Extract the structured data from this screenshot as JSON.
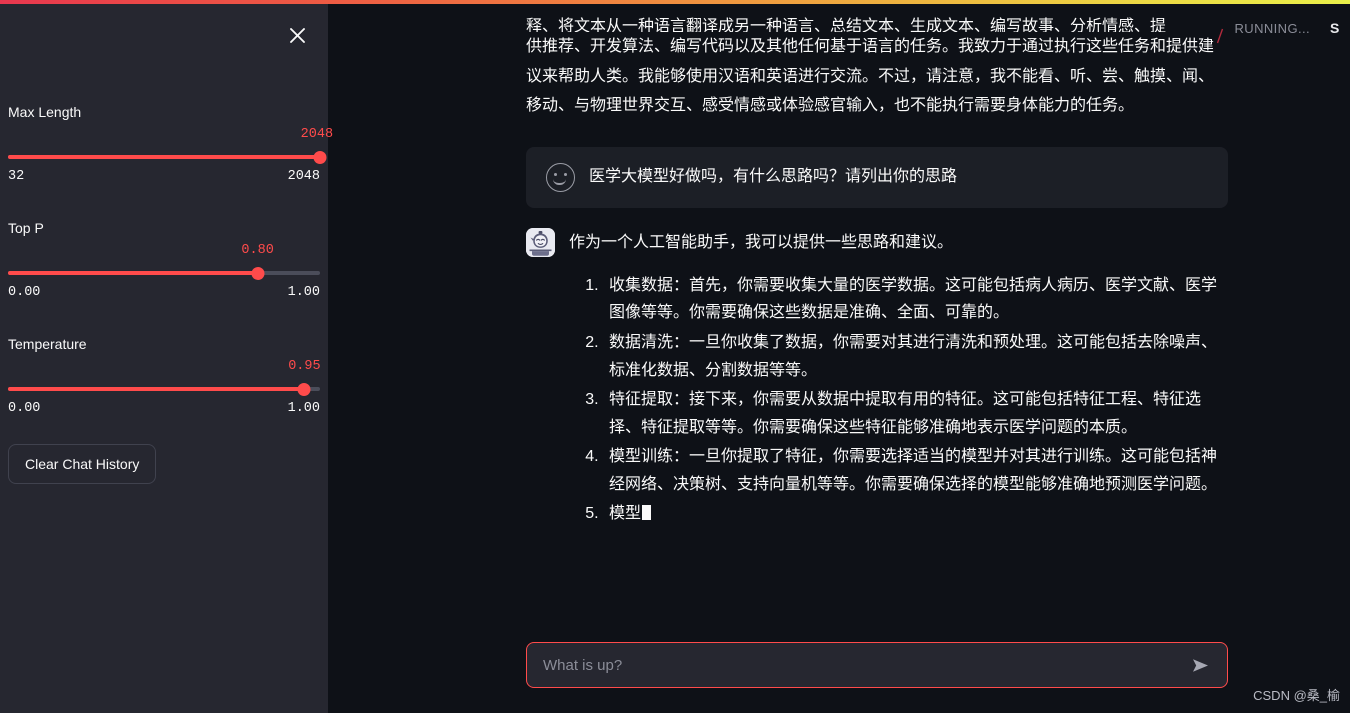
{
  "app": {
    "background": "#0e1117",
    "accent": "#ff4b4b",
    "sidebar_bg": "#262730"
  },
  "progress_bar": {
    "name": "running-progress-bar",
    "gradient_from": "#e8374f",
    "gradient_mid": "#f08a3f",
    "gradient_to": "#e9f04a"
  },
  "status": {
    "running_label": "RUNNING...",
    "stop_label": "S"
  },
  "sidebar": {
    "close_label": "×",
    "sliders": [
      {
        "label": "Max Length",
        "value": "2048",
        "min": "32",
        "max": "2048",
        "percent": 100
      },
      {
        "label": "Top P",
        "value": "0.80",
        "min": "0.00",
        "max": "1.00",
        "percent": 80
      },
      {
        "label": "Temperature",
        "value": "0.95",
        "min": "0.00",
        "max": "1.00",
        "percent": 95
      }
    ],
    "clear_button": "Clear Chat History"
  },
  "chat": {
    "scrolled_message": {
      "role": "assistant",
      "clipped_line": "释、将文本从一种语言翻译成另一种语言、总结文本、生成文本、编写故事、分析情感、提",
      "lines": [
        "供推荐、开发算法、编写代码以及其他任何基于语言的任务。我致力于通过执行这些任务和",
        "提供建议来帮助人类。我能够使用汉语和英语进行交流。不过，请注意，我不能看、听、",
        "尝、触摸、闻、移动、与物理世界交互、感受情感或体验感官输入，也不能执行需要身体能",
        "力的任务。"
      ]
    },
    "user_message": {
      "role": "user",
      "avatar": "smiley-face-icon",
      "text": "医学大模型好做吗，有什么思路吗？请列出你的思路"
    },
    "assistant_message": {
      "role": "assistant",
      "avatar": "monk-character-avatar",
      "lead": "作为一个人工智能助手，我可以提供一些思路和建议。",
      "steps": [
        "收集数据：首先，你需要收集大量的医学数据。这可能包括病人病历、医学文献、医学图像等等。你需要确保这些数据是准确、全面、可靠的。",
        "数据清洗：一旦你收集了数据，你需要对其进行清洗和预处理。这可能包括去除噪声、标准化数据、分割数据等等。",
        "特征提取：接下来，你需要从数据中提取有用的特征。这可能包括特征工程、特征选择、特征提取等等。你需要确保这些特征能够准确地表示医学问题的本质。",
        "模型训练：一旦你提取了特征，你需要选择适当的模型并对其进行训练。这可能包括神经网络、决策树、支持向量机等等。你需要确保选择的模型能够准确地预测医学问题。",
        "模型"
      ],
      "streaming": true
    }
  },
  "composer": {
    "placeholder": "What is up?",
    "value": "",
    "send_icon": "send-arrow-icon"
  },
  "watermark": {
    "text": "CSDN @桑_榆"
  }
}
